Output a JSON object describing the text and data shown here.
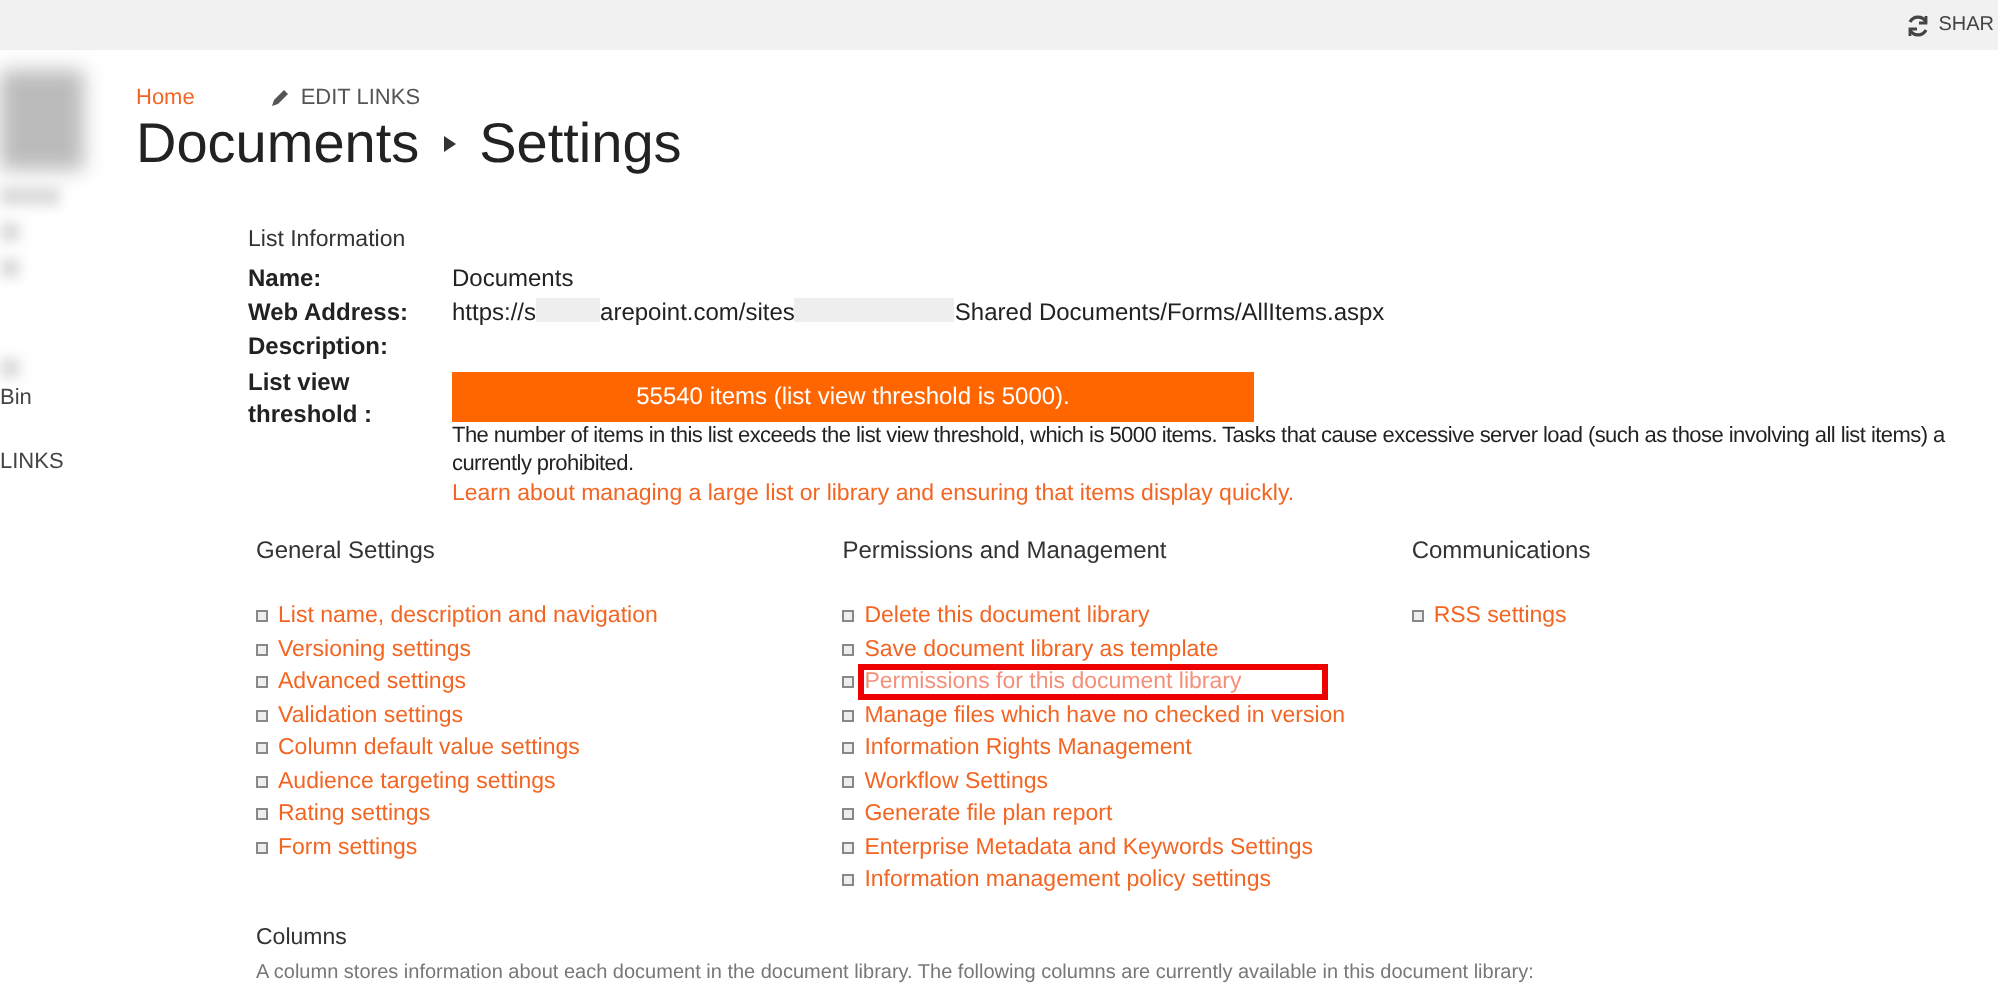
{
  "top_bar": {
    "share_label": "SHAR"
  },
  "left_nav": {
    "items": [
      {
        "label": "Bin"
      },
      {
        "label": "LINKS"
      }
    ]
  },
  "breadcrumb": {
    "home": "Home",
    "edit_links": "EDIT LINKS"
  },
  "title": {
    "parent": "Documents",
    "current": "Settings"
  },
  "list_information": {
    "heading": "List Information",
    "name_label": "Name:",
    "name_value": "Documents",
    "address_label": "Web Address:",
    "address_parts": [
      "https://s",
      "arepoint.com/sites",
      "Shared Documents/Forms/AllItems.aspx"
    ],
    "description_label": "Description:",
    "threshold_label": "List view threshold :",
    "threshold_banner": "55540 items (list view threshold is 5000).",
    "threshold_text_lines": [
      "The number of items in this list exceeds the list view threshold, which is 5000 items. Tasks that cause excessive server load (such as those involving all list items) a",
      "currently prohibited."
    ],
    "threshold_link": "Learn about managing a large list or library and ensuring that items display quickly."
  },
  "sections": [
    {
      "heading": "General Settings",
      "links": [
        {
          "label": "List name, description and navigation",
          "highlighted": false
        },
        {
          "label": "Versioning settings",
          "highlighted": false
        },
        {
          "label": "Advanced settings",
          "highlighted": false
        },
        {
          "label": "Validation settings",
          "highlighted": false
        },
        {
          "label": "Column default value settings",
          "highlighted": false
        },
        {
          "label": "Audience targeting settings",
          "highlighted": false
        },
        {
          "label": "Rating settings",
          "highlighted": false
        },
        {
          "label": "Form settings",
          "highlighted": false
        }
      ]
    },
    {
      "heading": "Permissions and Management",
      "links": [
        {
          "label": "Delete this document library",
          "highlighted": false
        },
        {
          "label": "Save document library as template",
          "highlighted": false
        },
        {
          "label": "Permissions for this document library",
          "highlighted": true
        },
        {
          "label": "Manage files which have no checked in version",
          "highlighted": false
        },
        {
          "label": "Information Rights Management",
          "highlighted": false
        },
        {
          "label": "Workflow Settings",
          "highlighted": false
        },
        {
          "label": "Generate file plan report",
          "highlighted": false
        },
        {
          "label": "Enterprise Metadata and Keywords Settings",
          "highlighted": false
        },
        {
          "label": "Information management policy settings",
          "highlighted": false
        }
      ]
    },
    {
      "heading": "Communications",
      "links": [
        {
          "label": "RSS settings",
          "highlighted": false
        }
      ]
    }
  ],
  "columns": {
    "heading": "Columns",
    "description": "A column stores information about each document in the document library. The following columns are currently available in this document library:"
  }
}
